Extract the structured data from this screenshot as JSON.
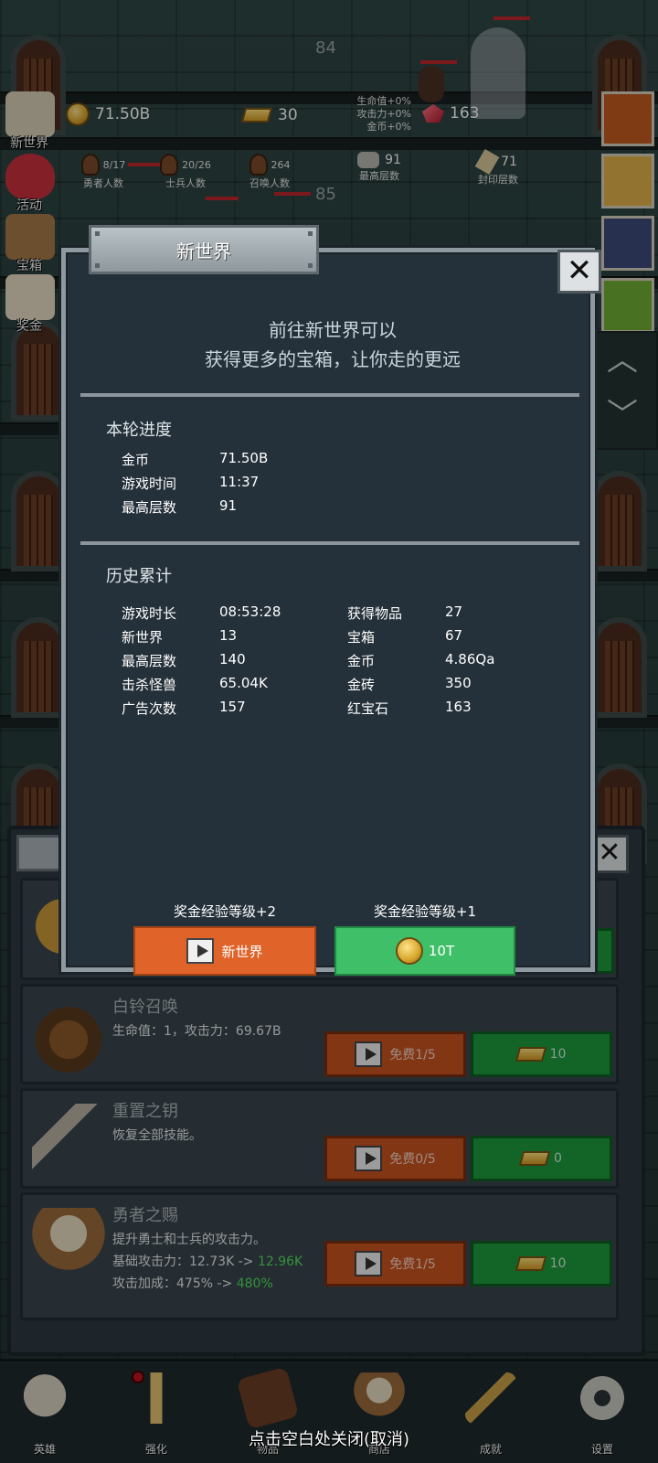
{
  "hud": {
    "gold": "71.50B",
    "gold_bars": "30",
    "buffs": [
      "生命值+0%",
      "攻击力+0%",
      "金币+0%"
    ],
    "rubies": "163",
    "floor_top": "84",
    "floor_mid": "85",
    "stats": [
      {
        "value": "8/17",
        "label": "勇者人数"
      },
      {
        "value": "20/26",
        "label": "士兵人数"
      },
      {
        "value": "264",
        "label": "召唤人数"
      },
      {
        "value": "91",
        "label": "最高层数"
      },
      {
        "value": "71",
        "label": "封印层数"
      }
    ]
  },
  "side_menu": [
    {
      "label": "新世界",
      "icon": "map-icon"
    },
    {
      "label": "活动",
      "icon": "heart-icon"
    },
    {
      "label": "宝箱",
      "icon": "chest-icon"
    },
    {
      "label": "奖金",
      "icon": "envelope-icon"
    }
  ],
  "modal": {
    "tab_title": "新世界",
    "intro_line1": "前往新世界可以",
    "intro_line2": "获得更多的宝箱，让你走的更远",
    "round_title": "本轮进度",
    "round": [
      {
        "label": "金币",
        "value": "71.50B"
      },
      {
        "label": "游戏时间",
        "value": "11:37"
      },
      {
        "label": "最高层数",
        "value": "91"
      }
    ],
    "history_title": "历史累计",
    "history_left": [
      {
        "label": "游戏时长",
        "value": "08:53:28"
      },
      {
        "label": "新世界",
        "value": "13"
      },
      {
        "label": "最高层数",
        "value": "140"
      },
      {
        "label": "击杀怪兽",
        "value": "65.04K"
      },
      {
        "label": "广告次数",
        "value": "157"
      }
    ],
    "history_right": [
      {
        "label": "获得物品",
        "value": "27"
      },
      {
        "label": "宝箱",
        "value": "67"
      },
      {
        "label": "金币",
        "value": "4.86Qa"
      },
      {
        "label": "金砖",
        "value": "350"
      },
      {
        "label": "红宝石",
        "value": "163"
      }
    ],
    "bonus_left": "奖金经验等级+2",
    "bonus_right": "奖金经验等级+1",
    "btn_newworld": "新世界",
    "btn_cost": "10T"
  },
  "items": [
    {
      "title": "白铃召唤",
      "line1": "生命值：1，攻击力：69.67B",
      "free": "免费1/5",
      "price": "10",
      "icon": "witch-icon"
    },
    {
      "title": "重置之钥",
      "line1": "恢复全部技能。",
      "free": "免费0/5",
      "price": "0",
      "icon": "key-icon"
    },
    {
      "title": "勇者之赐",
      "line1": "提升勇士和士兵的攻击力。",
      "line2_prefix": "基础攻击力：12.73K -> ",
      "line2_new": "12.96K",
      "line3_prefix": "攻击加成：475% -> ",
      "line3_new": "480%",
      "free": "免费1/5",
      "price": "10",
      "icon": "beer-mug-icon"
    }
  ],
  "bottom_nav": [
    {
      "label": "英雄",
      "icon": "skull-icon"
    },
    {
      "label": "强化",
      "icon": "candle-icon"
    },
    {
      "label": "物品",
      "icon": "book-icon"
    },
    {
      "label": "商店",
      "icon": "mug-icon"
    },
    {
      "label": "成就",
      "icon": "key-icon"
    },
    {
      "label": "设置",
      "icon": "gear-icon"
    }
  ],
  "close_hint": "点击空白处关闭(取消)",
  "colors": {
    "modal_bg": "#25313a",
    "orange_button": "#e0632a",
    "green_button": "#3fbf68",
    "highlight_green": "#4ee05a"
  }
}
